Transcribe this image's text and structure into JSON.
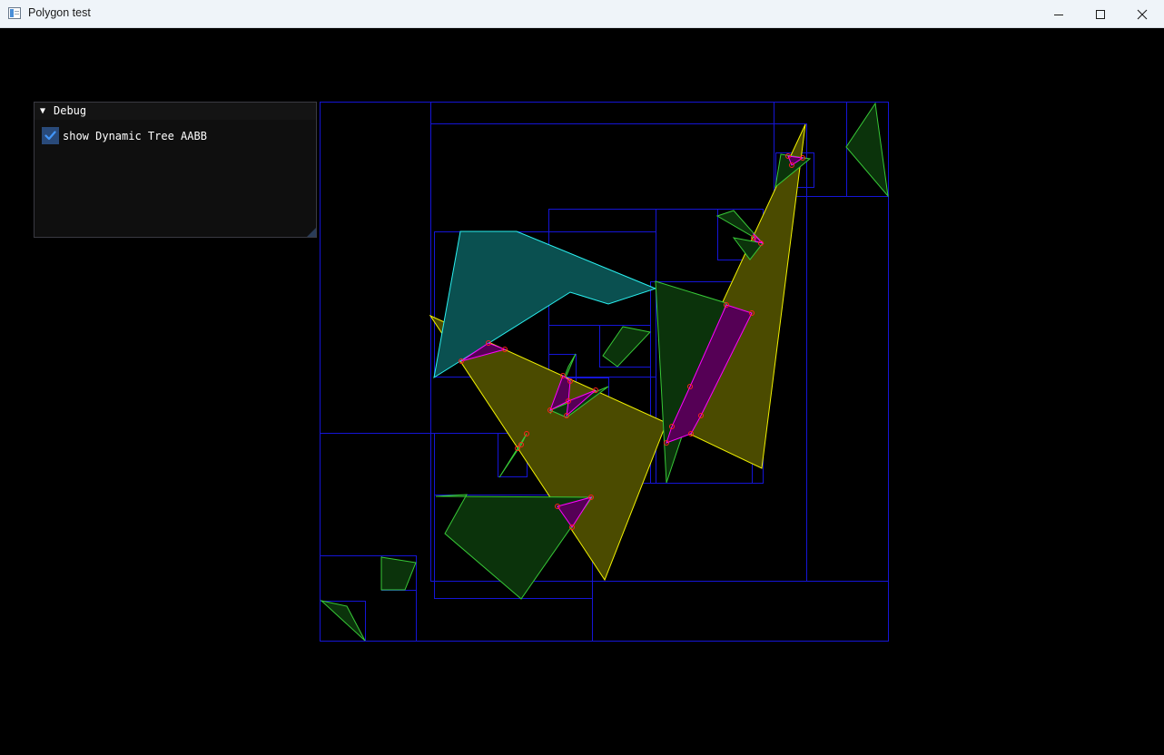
{
  "window": {
    "title": "Polygon test",
    "controls": [
      "minimize",
      "maximize",
      "close"
    ]
  },
  "debug_panel": {
    "title": "Debug",
    "collapse_icon": "triangle-down",
    "checkbox_label": "show Dynamic Tree AABB",
    "checkbox_checked": true
  },
  "colors": {
    "background": "#000000",
    "aabb": "#1515d6",
    "ground_polygon": "#4b4b00",
    "ground_outline": "#f2f200",
    "dynamic_polygon": "#0b330b",
    "dynamic_outline": "#37c837",
    "awake_polygon": "#0a5050",
    "awake_outline": "#2af0f0",
    "intersection_fill": "#550055",
    "intersection_outline": "#ff00ff",
    "contact_points": "#ff2020",
    "checkbox_accent": "#4296fa"
  }
}
